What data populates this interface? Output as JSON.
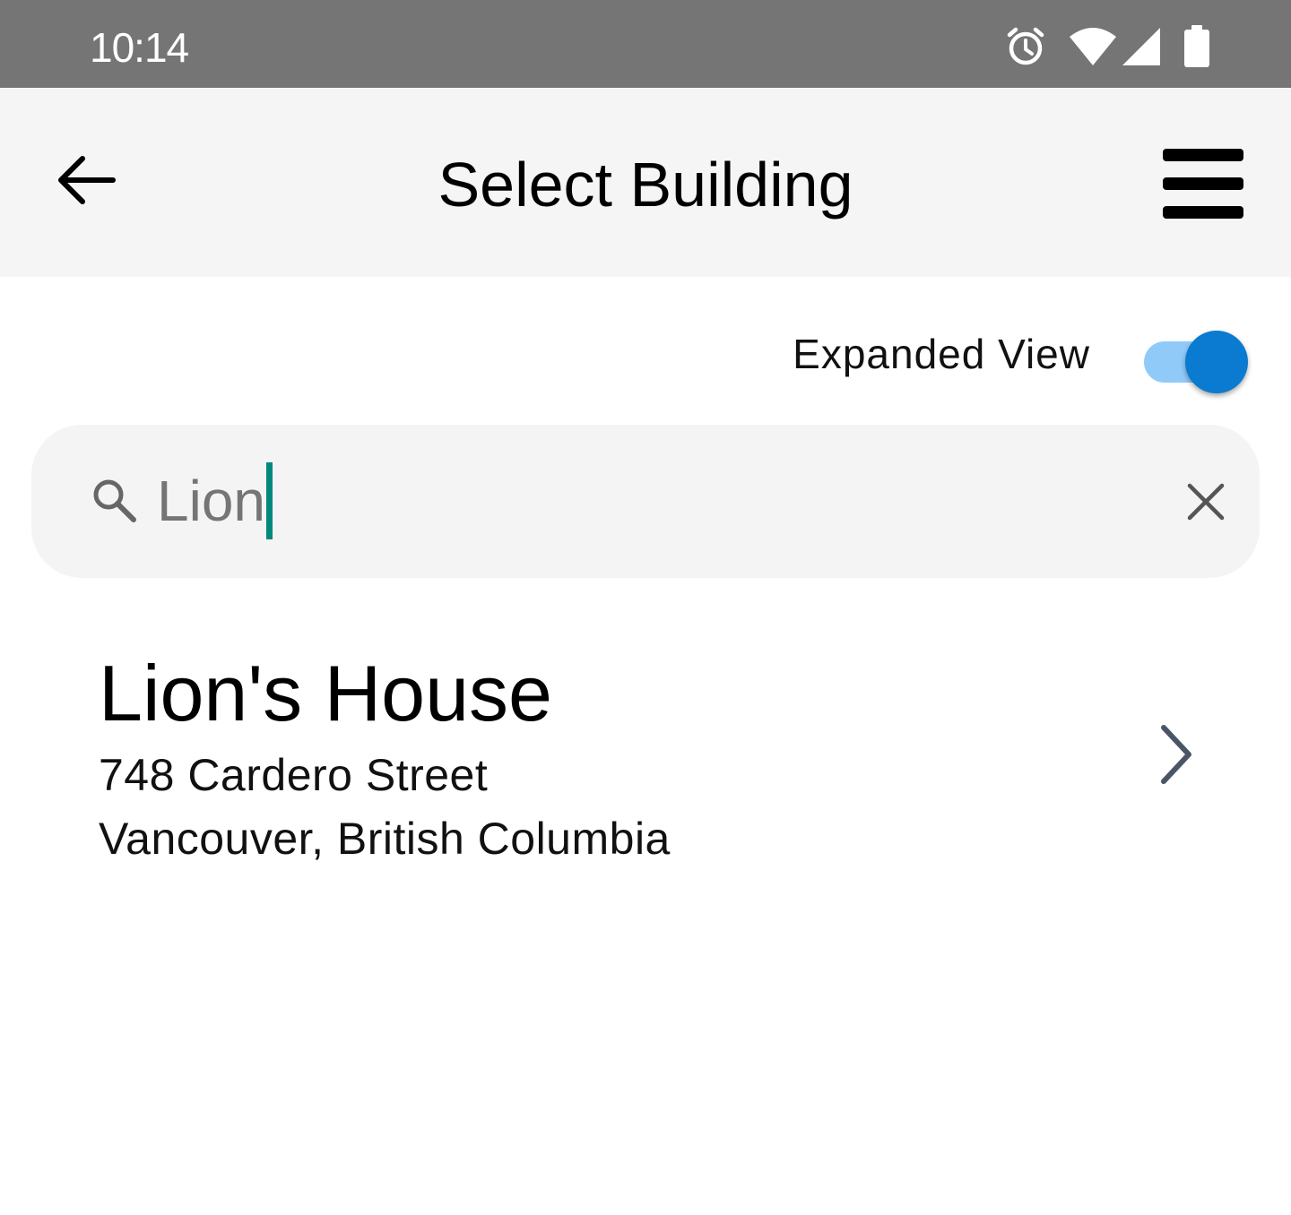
{
  "status_bar": {
    "time": "10:14",
    "icons": [
      "alarm-icon",
      "wifi-icon",
      "cell-signal-icon",
      "battery-icon"
    ]
  },
  "app_bar": {
    "title": "Select Building",
    "back_icon": "arrow-left-icon",
    "menu_icon": "hamburger-menu-icon"
  },
  "view_toggle": {
    "label": "Expanded View",
    "checked": true
  },
  "search": {
    "value": "Lion",
    "icon": "search-icon",
    "clear_icon": "close-icon"
  },
  "results": [
    {
      "name": "Lion's House",
      "street": "748 Cardero Street",
      "city": "Vancouver, British Columbia",
      "icon": "chevron-right-icon"
    }
  ],
  "colors": {
    "status_bar": "#757575",
    "app_bar": "#f5f5f5",
    "toggle_track": "#90caf9",
    "toggle_knob": "#0a7bd0",
    "caret": "#00897b",
    "search_bg": "#f4f4f4",
    "chevron": "#4a5566"
  }
}
